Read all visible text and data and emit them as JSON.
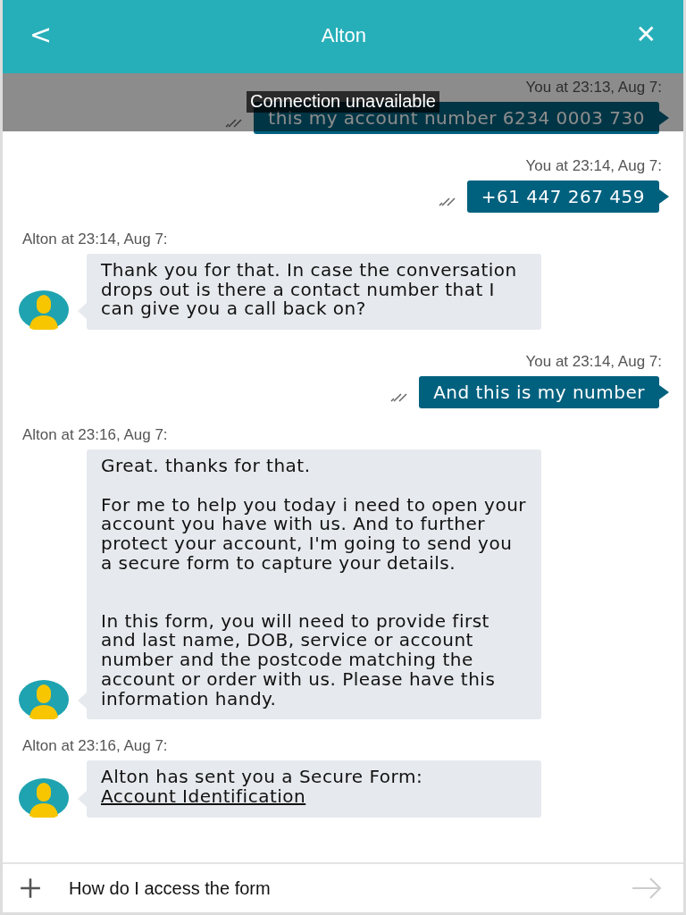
{
  "header": {
    "back": "<",
    "title": "Alton",
    "close": "✕"
  },
  "banner": {
    "text": "Connection unavailable"
  },
  "messages": [
    {
      "kind": "out",
      "meta": "You at 23:13, Aug 7:",
      "text": "this my account number 6234 0003 730"
    },
    {
      "kind": "out",
      "meta": "You at 23:14, Aug 7:",
      "text": "+61 447 267 459"
    },
    {
      "kind": "in",
      "meta": "Alton at 23:14, Aug 7:",
      "text": "Thank you for that. In case the conversation drops out is there a contact number that I can give you a call back on?"
    },
    {
      "kind": "out",
      "meta": "You at 23:14, Aug 7:",
      "text": "And this is my number"
    },
    {
      "kind": "in",
      "meta": "Alton at 23:16, Aug 7:",
      "text": "Great. thanks for that.\n\nFor me to help you today i need to open your account you have with us. And to further protect your account, I'm going to send you a secure form to capture your details.\n\n\nIn this form, you will need to provide first and last name, DOB, service or account number and the postcode matching the account or order with us. Please have this information handy."
    },
    {
      "kind": "in",
      "meta": "Alton at 23:16, Aug 7:",
      "text": "Alton has sent you a Secure Form:",
      "link": "Account Identification"
    }
  ],
  "composer": {
    "value": "How do I access the form"
  }
}
